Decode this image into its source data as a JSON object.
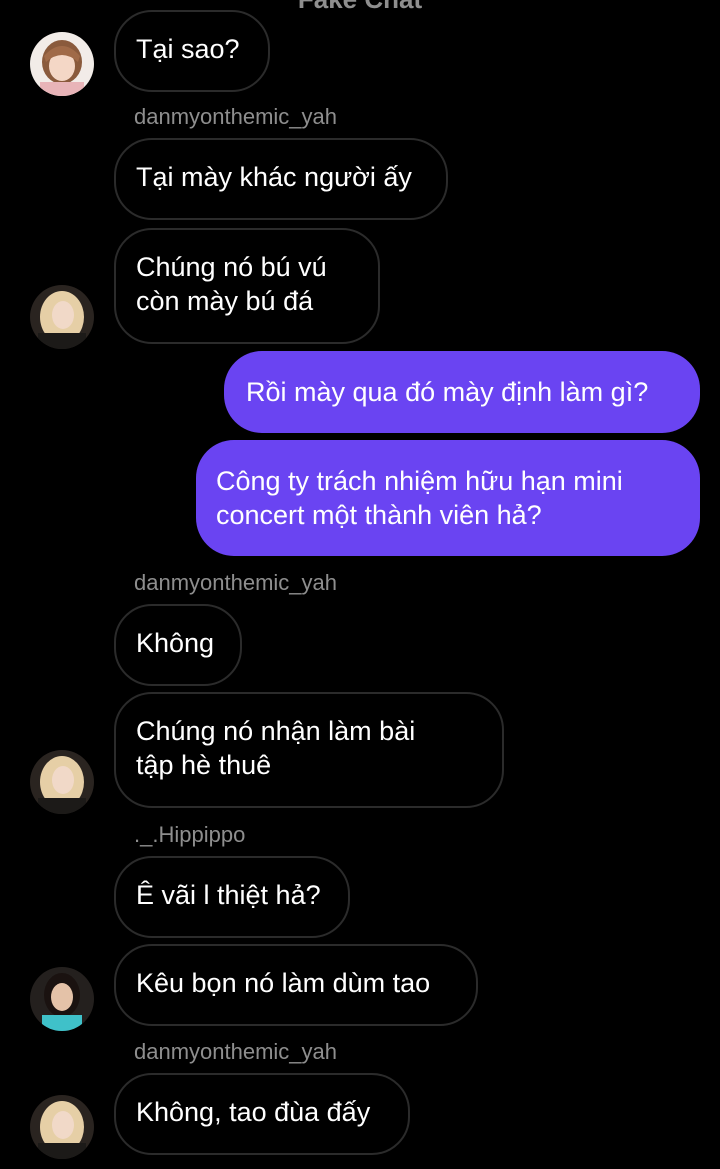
{
  "header": {
    "title": "Fake Chat"
  },
  "messages": {
    "m1": {
      "lines": [
        "Tại sao?"
      ]
    },
    "s1": "danmyonthemic_yah",
    "m2": {
      "lines": [
        "Tại mày khác người ấy"
      ]
    },
    "m3": {
      "lines": [
        "Chúng nó bú vú",
        "còn mày bú đá"
      ]
    },
    "m4": {
      "lines": [
        "Rồi mày qua đó mày định làm gì?"
      ]
    },
    "m5": {
      "lines": [
        "Công ty trách nhiệm hữu hạn mini",
        "concert một thành viên hả?"
      ]
    },
    "s2": "danmyonthemic_yah",
    "m6": {
      "lines": [
        "Không"
      ]
    },
    "m7": {
      "lines": [
        "Chúng nó nhận làm bài",
        "tập hè thuê"
      ]
    },
    "s3": "._.Hippippo",
    "m8": {
      "lines": [
        "Ê vãi l thiệt hả?"
      ]
    },
    "m9": {
      "lines": [
        "Kêu bọn nó làm dùm tao"
      ]
    },
    "s4": "danmyonthemic_yah",
    "m10": {
      "lines": [
        "Không, tao đùa đấy"
      ]
    }
  },
  "avatars": {
    "a1": "girl-pink-hair-avatar",
    "a2": "blonde-girl-avatar",
    "a3": "blonde-girl-avatar",
    "a4": "dark-hair-girl-avatar",
    "a5": "blonde-girl-avatar"
  },
  "colors": {
    "background": "#000000",
    "outgoing_bubble": "#6a44f2",
    "incoming_border": "#2b2b2b",
    "sender_text": "#8e8e8e"
  }
}
